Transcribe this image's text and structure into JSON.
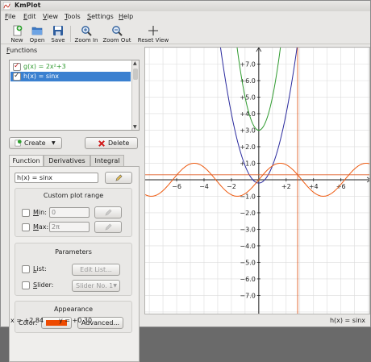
{
  "window": {
    "title": "KmPlot"
  },
  "menu": [
    "File",
    "Edit",
    "View",
    "Tools",
    "Settings",
    "Help"
  ],
  "toolbar": [
    {
      "label": "New",
      "icon": "new-file-icon"
    },
    {
      "label": "Open",
      "icon": "open-folder-icon"
    },
    {
      "label": "Save",
      "icon": "save-icon"
    },
    {
      "label": "Zoom In",
      "icon": "zoom-in-icon"
    },
    {
      "label": "Zoom Out",
      "icon": "zoom-out-icon"
    },
    {
      "label": "Reset View",
      "icon": "reset-view-icon"
    }
  ],
  "functions_panel": {
    "title": "Functions",
    "items": [
      {
        "text": "g(x) = 2x²+3",
        "checked": true,
        "selected": false,
        "color": "#2e9a2e"
      },
      {
        "text": "h(x) = sinx",
        "checked": true,
        "selected": true,
        "color": "#ee5a10"
      }
    ],
    "create_label": "Create",
    "delete_label": "Delete"
  },
  "tabs": [
    "Function",
    "Derivatives",
    "Integral"
  ],
  "function_tab": {
    "equation": "h(x) = sinx",
    "custom_range": {
      "title": "Custom plot range",
      "min_label": "Min:",
      "min_value": "0",
      "max_label": "Max:",
      "max_value": "2π"
    },
    "parameters": {
      "title": "Parameters",
      "list_label": "List:",
      "edit_list_label": "Edit List...",
      "slider_label": "Slider:",
      "slider_value": "Slider No. 1"
    },
    "appearance": {
      "title": "Appearance",
      "color_label": "Color:",
      "color_value": "#ee4a00",
      "advanced_label": "Advanced..."
    }
  },
  "status": {
    "x": "x = +2.84",
    "y": "y = +0.30",
    "function": "h(x) = sinx"
  },
  "chart_data": {
    "type": "line",
    "xlim": [
      -8.3,
      8.2
    ],
    "ylim": [
      -8.2,
      8.0
    ],
    "x_ticks": [
      "−6",
      "−4",
      "−2",
      "+2",
      "+4",
      "+6"
    ],
    "x_tick_values": [
      -6,
      -4,
      -2,
      2,
      4,
      6
    ],
    "y_ticks": [
      "+7.0",
      "+6.0",
      "+5.0",
      "+4.0",
      "+3.0",
      "+2.0",
      "+1.0",
      "−1.0",
      "−2.0",
      "−3.0",
      "−4.0",
      "−5.0",
      "−6.0",
      "−7.0"
    ],
    "y_tick_values": [
      7,
      6,
      5,
      4,
      3,
      2,
      1,
      -1,
      -2,
      -3,
      -4,
      -5,
      -6,
      -7
    ],
    "grid": true,
    "crosshair": {
      "x": 2.84,
      "y": 0.3
    },
    "series": [
      {
        "expr": "g(x)=2x^2+3",
        "color": "#2e9a2e"
      },
      {
        "expr": "blue parabola",
        "color": "#2a2a9e"
      },
      {
        "expr": "h(x)=sinx",
        "color": "#ee5a10"
      }
    ]
  }
}
